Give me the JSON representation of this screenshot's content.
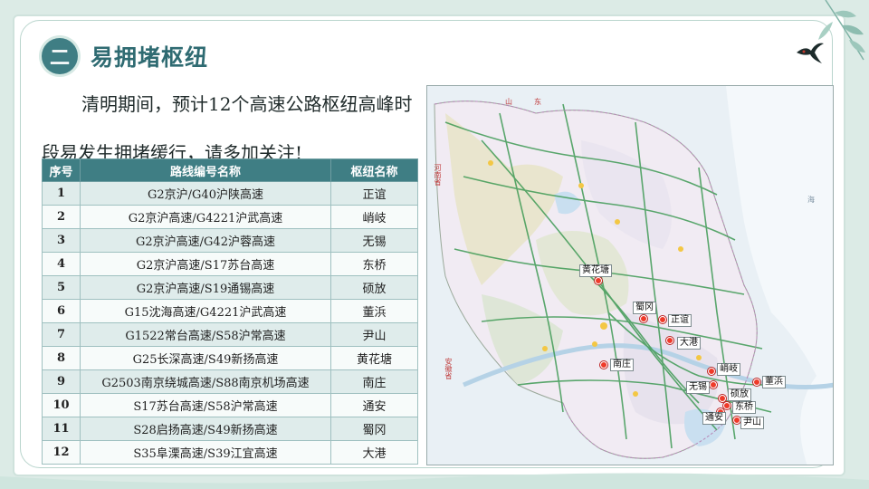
{
  "header": {
    "badge": "二",
    "title": "易拥堵枢纽"
  },
  "intro": "清明期间，预计12个高速公路枢纽高峰时段易发生拥堵缓行，请多加关注!",
  "table": {
    "columns": [
      "序号",
      "路线编号名称",
      "枢纽名称"
    ],
    "rows": [
      {
        "no": "1",
        "route": "G2京沪/G40沪陕高速",
        "hub": "正谊"
      },
      {
        "no": "2",
        "route": "G2京沪高速/G4221沪武高速",
        "hub": "峭岐"
      },
      {
        "no": "3",
        "route": "G2京沪高速/G42沪蓉高速",
        "hub": "无锡"
      },
      {
        "no": "4",
        "route": "G2京沪高速/S17苏台高速",
        "hub": "东桥"
      },
      {
        "no": "5",
        "route": "G2京沪高速/S19通锡高速",
        "hub": "硕放"
      },
      {
        "no": "6",
        "route": "G15沈海高速/G4221沪武高速",
        "hub": "董浜"
      },
      {
        "no": "7",
        "route": "G1522常台高速/S58沪常高速",
        "hub": "尹山"
      },
      {
        "no": "8",
        "route": "G25长深高速/S49新扬高速",
        "hub": "黄花塘"
      },
      {
        "no": "9",
        "route": "G2503南京绕城高速/S88南京机场高速",
        "hub": "南庄"
      },
      {
        "no": "10",
        "route": "S17苏台高速/S58沪常高速",
        "hub": "通安"
      },
      {
        "no": "11",
        "route": "S28启扬高速/S49新扬高速",
        "hub": "蜀冈"
      },
      {
        "no": "12",
        "route": "S35阜溧高速/S39江宜高速",
        "hub": "大港"
      }
    ]
  },
  "map": {
    "labels": [
      "黄花塘",
      "蜀冈",
      "正谊",
      "大港",
      "南庄",
      "峭岐",
      "董浜",
      "无锡",
      "硕放",
      "东桥",
      "通安",
      "尹山"
    ],
    "captions": [
      "山",
      "东",
      "河南省",
      "安徽省",
      "海"
    ]
  },
  "colors": {
    "accent": "#3f7e84",
    "marker": "#ef3a2a"
  }
}
